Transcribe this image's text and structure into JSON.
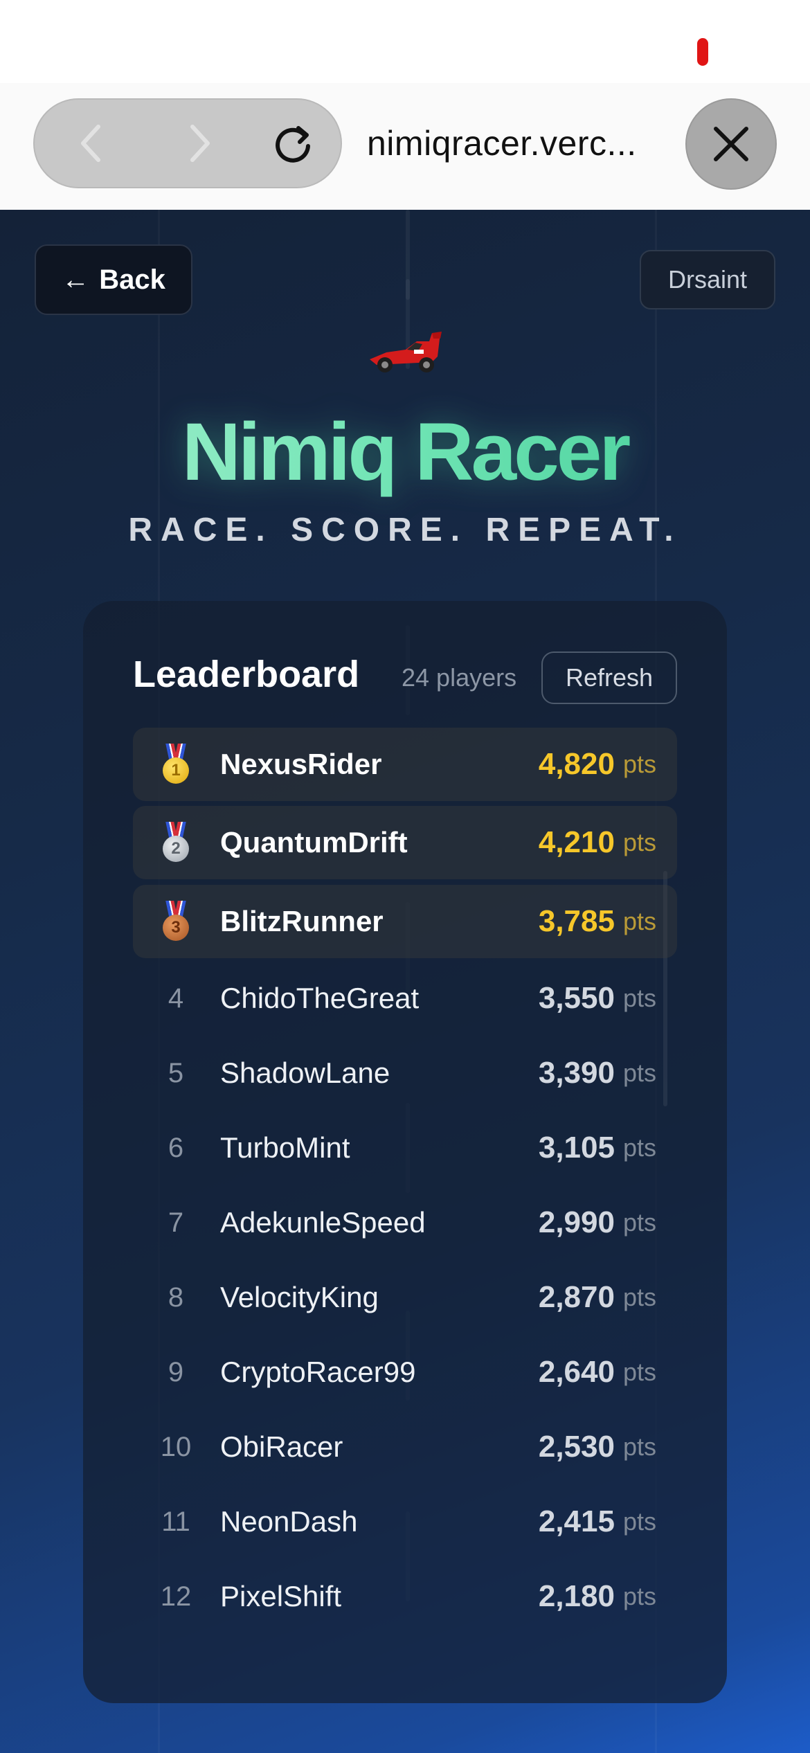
{
  "browser": {
    "url": "nimiqracer.verc...",
    "icons": {
      "back": "chevron-left-icon",
      "forward": "chevron-right-icon",
      "reload": "reload-icon",
      "close": "close-icon"
    }
  },
  "header": {
    "back_label": "Back",
    "user_name": "Drsaint",
    "car_icon": "race-car-icon"
  },
  "hero": {
    "title": "Nimiq Racer",
    "tagline": "RACE. SCORE. REPEAT."
  },
  "leaderboard": {
    "title": "Leaderboard",
    "player_count": "24 players",
    "refresh_label": "Refresh",
    "unit": "pts",
    "rows": [
      {
        "rank": "1",
        "medal": "gold",
        "name": "NexusRider",
        "score": "4,820"
      },
      {
        "rank": "2",
        "medal": "silver",
        "name": "QuantumDrift",
        "score": "4,210"
      },
      {
        "rank": "3",
        "medal": "bronze",
        "name": "BlitzRunner",
        "score": "3,785"
      },
      {
        "rank": "4",
        "name": "ChidoTheGreat",
        "score": "3,550"
      },
      {
        "rank": "5",
        "name": "ShadowLane",
        "score": "3,390"
      },
      {
        "rank": "6",
        "name": "TurboMint",
        "score": "3,105"
      },
      {
        "rank": "7",
        "name": "AdekunleSpeed",
        "score": "2,990"
      },
      {
        "rank": "8",
        "name": "VelocityKing",
        "score": "2,870"
      },
      {
        "rank": "9",
        "name": "CryptoRacer99",
        "score": "2,640"
      },
      {
        "rank": "10",
        "name": "ObiRacer",
        "score": "2,530"
      },
      {
        "rank": "11",
        "name": "NeonDash",
        "score": "2,415"
      },
      {
        "rank": "12",
        "name": "PixelShift",
        "score": "2,180"
      }
    ]
  },
  "colors": {
    "title_accent": "#6fe4b4",
    "score_gold": "#f6c72a",
    "page_bg_start": "#142238",
    "page_bg_end": "#1d5cc8"
  }
}
